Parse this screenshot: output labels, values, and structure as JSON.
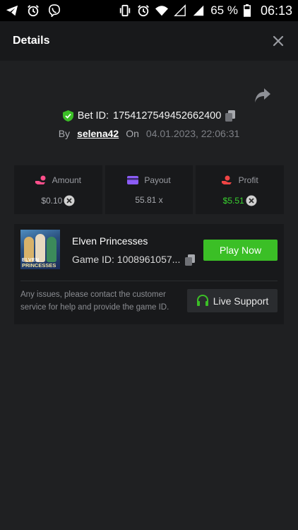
{
  "status_bar": {
    "battery_percent": "65 %",
    "time": "06:13",
    "left_icons": [
      "telegram-icon",
      "alarm-icon",
      "viber-icon"
    ],
    "right_icons": [
      "vibrate-icon",
      "alarm-icon",
      "wifi-icon",
      "signal-empty-icon",
      "signal-icon",
      "battery-icon"
    ]
  },
  "header": {
    "title": "Details"
  },
  "bet": {
    "id_label": "Bet ID:",
    "id": "1754127549452662400",
    "by_label": "By",
    "user": "selena42",
    "on_label": "On",
    "date": "04.01.2023, 22:06:31"
  },
  "stats": {
    "amount": {
      "label": "Amount",
      "value": "$0.10"
    },
    "payout": {
      "label": "Payout",
      "value": "55.81 x"
    },
    "profit": {
      "label": "Profit",
      "value": "$5.51"
    }
  },
  "game": {
    "name": "Elven Princesses",
    "id_label": "Game ID:",
    "id": "1008961057...",
    "thumb_line1": "ELVEN",
    "thumb_line2": "PRINCESSES",
    "play_label": "Play Now"
  },
  "support": {
    "text": "Any issues, please contact the customer service for help and provide the game ID.",
    "button_label": "Live Support"
  },
  "colors": {
    "accent_green": "#3bbf26",
    "profit_green": "#39d22f",
    "amount_pink": "#ff4f8b",
    "payout_purple": "#8b5cf6",
    "profit_red": "#ef4444"
  }
}
